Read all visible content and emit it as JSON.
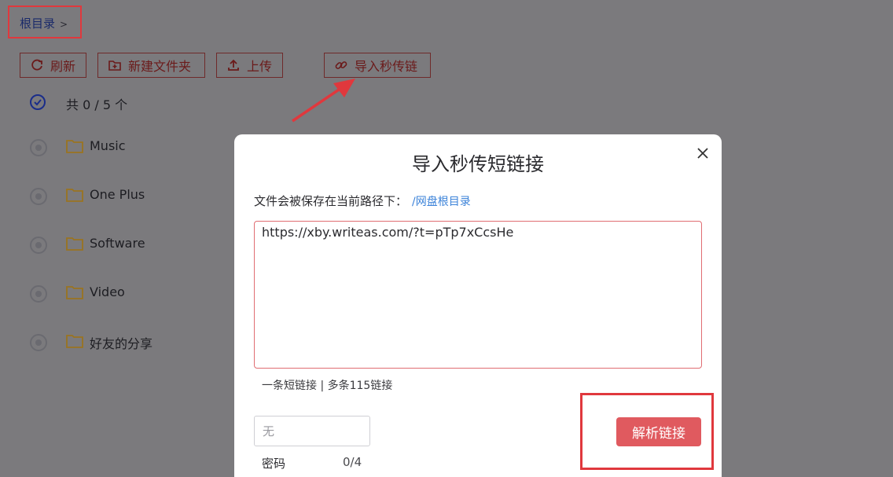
{
  "breadcrumb": {
    "root": "根目录",
    "separator": ">"
  },
  "toolbar": {
    "refresh": "刷新",
    "new_folder": "新建文件夹",
    "upload": "上传",
    "import_link": "导入秒传链"
  },
  "list": {
    "count_text": "共 0 / 5 个",
    "items": [
      {
        "name": "Music"
      },
      {
        "name": "One Plus"
      },
      {
        "name": "Software"
      },
      {
        "name": "Video"
      },
      {
        "name": "好友的分享"
      }
    ]
  },
  "dialog": {
    "title": "导入秒传短链接",
    "path_label": "文件会被保存在当前路径下：",
    "path_link": "/网盘根目录",
    "link_value": "https://xby.writeas.com/?t=pTp7xCcsHe",
    "hint": "一条短链接 | 多条115链接",
    "password_placeholder": "无",
    "password_label": "密码",
    "password_count": "0/4",
    "parse_button": "解析链接"
  },
  "colors": {
    "accent": "#e05a5f",
    "link": "#3c83d9",
    "highlight": "#e0383d",
    "overlay": "#7a7a7d"
  }
}
